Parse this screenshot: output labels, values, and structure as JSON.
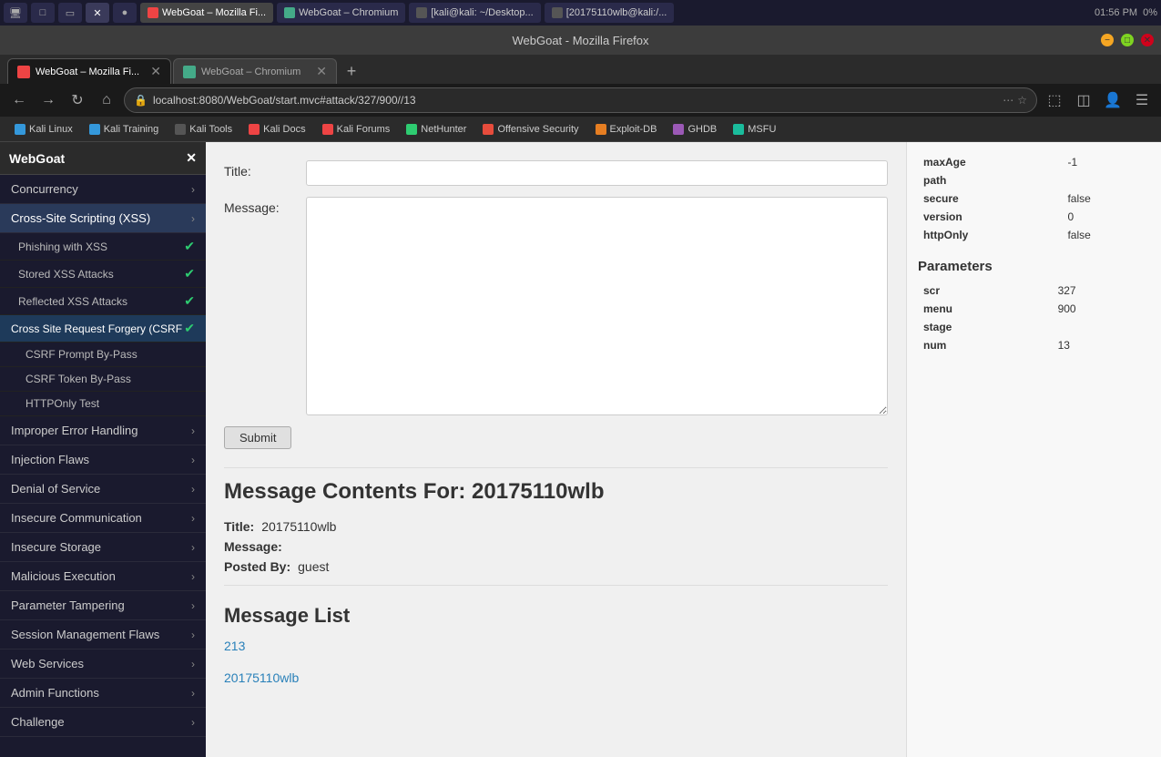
{
  "os_bar": {
    "icons": [
      "⊞",
      "□",
      "▭",
      "✕",
      "●"
    ],
    "tabs": [
      {
        "label": "WebGoat – Mozilla Fi...",
        "active": true,
        "favicon": "firefox"
      },
      {
        "label": "WebGoat – Chromium",
        "active": false,
        "favicon": "chrome"
      },
      {
        "label": "[kali@kali: ~/Desktop...",
        "active": false,
        "favicon": "terminal"
      },
      {
        "label": "[20175110wlb@kali:/...",
        "active": false,
        "favicon": "terminal"
      }
    ],
    "time": "01:56 PM",
    "battery": "0%"
  },
  "browser": {
    "title": "WebGoat - Mozilla Firefox",
    "tabs": [
      {
        "label": "WebGoat – Mozilla Fi...",
        "active": true
      },
      {
        "label": "WebGoat – Chromium",
        "active": false
      }
    ],
    "url": "localhost:8080/WebGoat/start.mvc#attack/327/900//13",
    "bookmarks": [
      {
        "label": "Kali Linux",
        "icon_class": "bf-kali"
      },
      {
        "label": "Kali Training",
        "icon_class": "bf-kali2"
      },
      {
        "label": "Kali Tools",
        "icon_class": "bf-tools"
      },
      {
        "label": "Kali Docs",
        "icon_class": "bf-docs"
      },
      {
        "label": "Kali Forums",
        "icon_class": "bf-forums"
      },
      {
        "label": "NetHunter",
        "icon_class": "bf-net"
      },
      {
        "label": "Offensive Security",
        "icon_class": "bf-off"
      },
      {
        "label": "Exploit-DB",
        "icon_class": "bf-exploit"
      },
      {
        "label": "GHDB",
        "icon_class": "bf-ghdb"
      },
      {
        "label": "MSFU",
        "icon_class": "bf-msfu"
      }
    ]
  },
  "sidebar": {
    "title": "WebGoat",
    "sections": [
      {
        "label": "Concurrency",
        "expanded": false,
        "items": []
      },
      {
        "label": "Cross-Site Scripting (XSS)",
        "expanded": true,
        "items": [
          {
            "label": "Phishing with XSS",
            "checked": true,
            "active": false
          },
          {
            "label": "Stored XSS Attacks",
            "checked": true,
            "active": false
          },
          {
            "label": "Reflected XSS Attacks",
            "checked": true,
            "active": false
          },
          {
            "label": "Cross Site Request Forgery (CSRF",
            "checked": true,
            "active": true,
            "subitems": [
              {
                "label": "CSRF Prompt By-Pass",
                "checked": false
              },
              {
                "label": "CSRF Token By-Pass",
                "checked": false
              },
              {
                "label": "HTTPOnly Test",
                "checked": false
              }
            ]
          }
        ]
      },
      {
        "label": "Improper Error Handling",
        "expanded": false,
        "items": []
      },
      {
        "label": "Injection Flaws",
        "expanded": false,
        "items": []
      },
      {
        "label": "Denial of Service",
        "expanded": false,
        "items": []
      },
      {
        "label": "Insecure Communication",
        "expanded": false,
        "items": []
      },
      {
        "label": "Insecure Storage",
        "expanded": false,
        "items": []
      },
      {
        "label": "Malicious Execution",
        "expanded": false,
        "items": []
      },
      {
        "label": "Parameter Tampering",
        "expanded": false,
        "items": []
      },
      {
        "label": "Session Management Flaws",
        "expanded": false,
        "items": []
      },
      {
        "label": "Web Services",
        "expanded": false,
        "items": []
      },
      {
        "label": "Admin Functions",
        "expanded": false,
        "items": []
      },
      {
        "label": "Challenge",
        "expanded": false,
        "items": []
      }
    ]
  },
  "form": {
    "title_label": "Title:",
    "message_label": "Message:",
    "submit_label": "Submit"
  },
  "message_contents": {
    "heading": "Message Contents For: 20175110wlb",
    "title_label": "Title:",
    "title_value": "20175110wlb",
    "message_label": "Message:",
    "message_value": "",
    "posted_by_label": "Posted By:",
    "posted_by_value": "guest"
  },
  "message_list": {
    "heading": "Message List",
    "links": [
      "213",
      "20175110wlb"
    ]
  },
  "right_panel": {
    "cookie_table": [
      {
        "key": "maxAge",
        "value": "-1"
      },
      {
        "key": "path",
        "value": ""
      },
      {
        "key": "secure",
        "value": "false"
      },
      {
        "key": "version",
        "value": "0"
      },
      {
        "key": "httpOnly",
        "value": "false"
      }
    ],
    "params_title": "Parameters",
    "params_table": [
      {
        "key": "scr",
        "value": "327"
      },
      {
        "key": "menu",
        "value": "900"
      },
      {
        "key": "stage",
        "value": ""
      },
      {
        "key": "num",
        "value": "13"
      }
    ]
  }
}
